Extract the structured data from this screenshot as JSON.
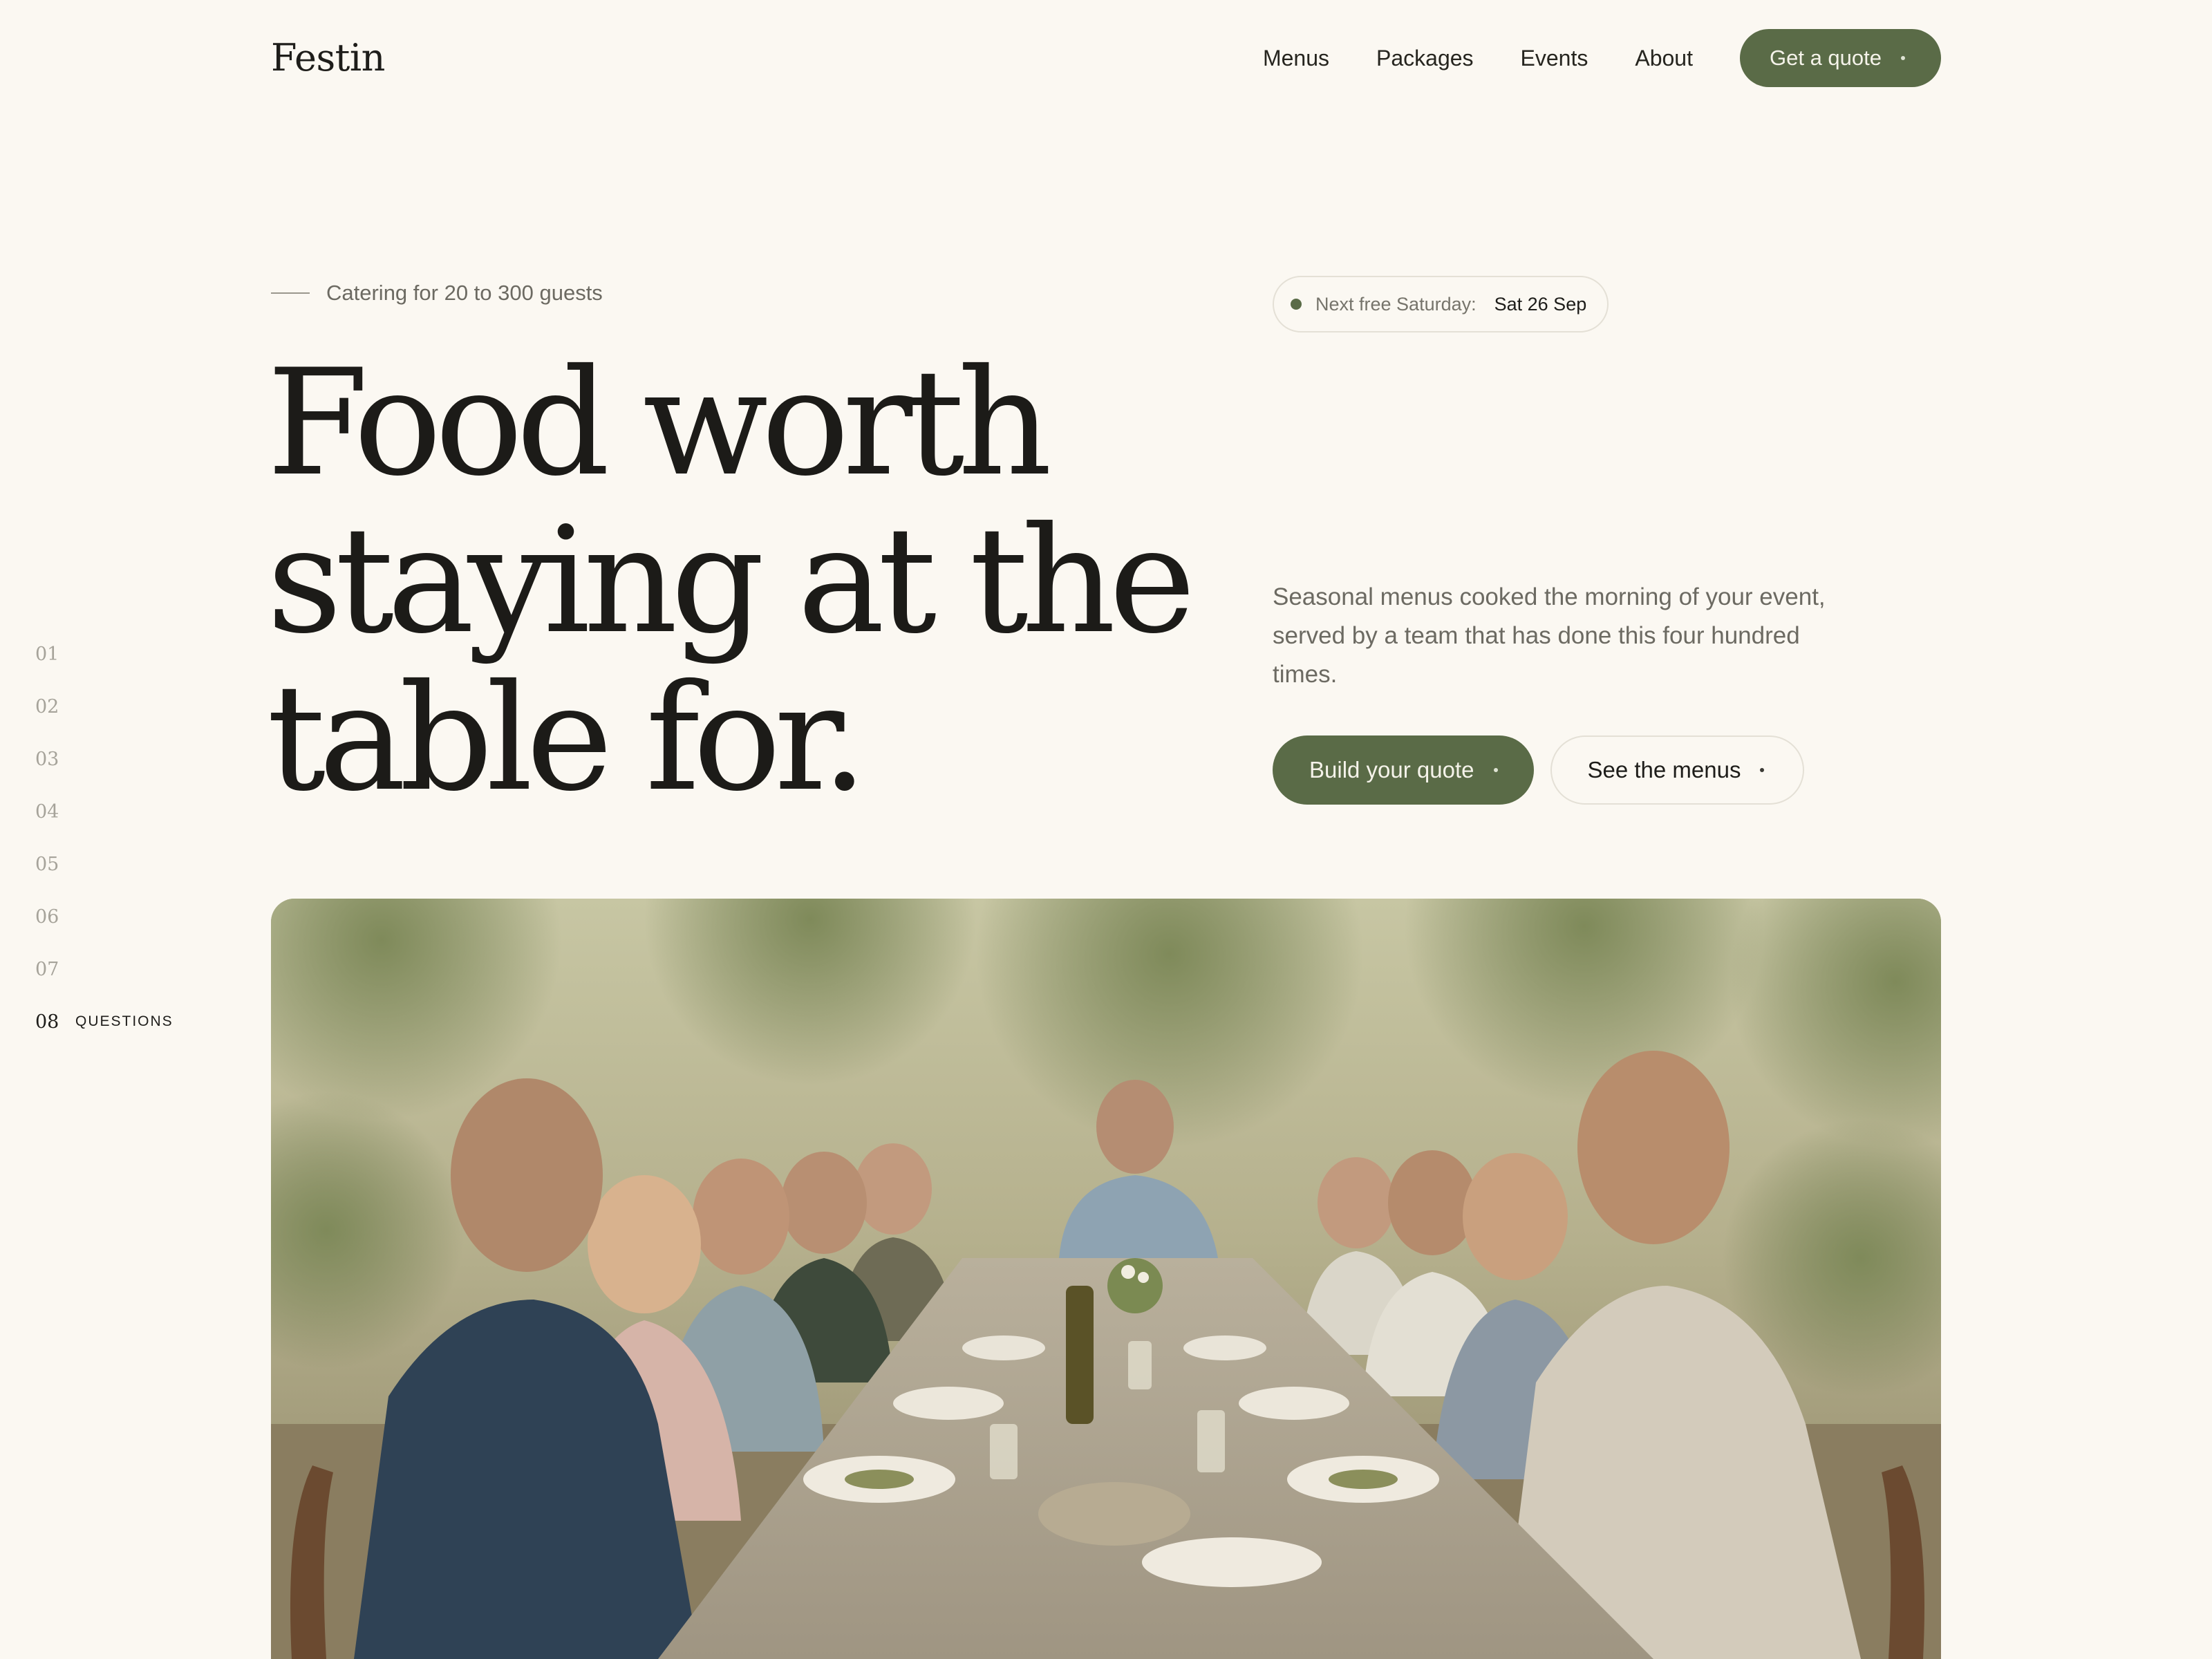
{
  "brand": {
    "name": "Festin"
  },
  "nav": {
    "links": [
      "Menus",
      "Packages",
      "Events",
      "About"
    ],
    "cta": "Get a quote"
  },
  "hero": {
    "eyebrow": "Catering for 20 to 300 guests",
    "availability": {
      "label": "Next free Saturday:",
      "value": "Sat 26 Sep"
    },
    "headline": [
      "Food worth",
      "staying at the",
      "table for."
    ],
    "intro": "Seasonal menus cooked the morning of your event, served by a team that has done this four hundred times.",
    "primary_cta": "Build your quote",
    "secondary_cta": "See the menus"
  },
  "sections": {
    "numbers": [
      "01",
      "02",
      "03",
      "04",
      "05",
      "06",
      "07",
      "08"
    ],
    "active": "08",
    "active_label": "QUESTIONS"
  },
  "colors": {
    "background": "#fbf8f2",
    "accent": "#5a6b47",
    "text": "#1e1d1a",
    "muted": "#6c6a62"
  }
}
